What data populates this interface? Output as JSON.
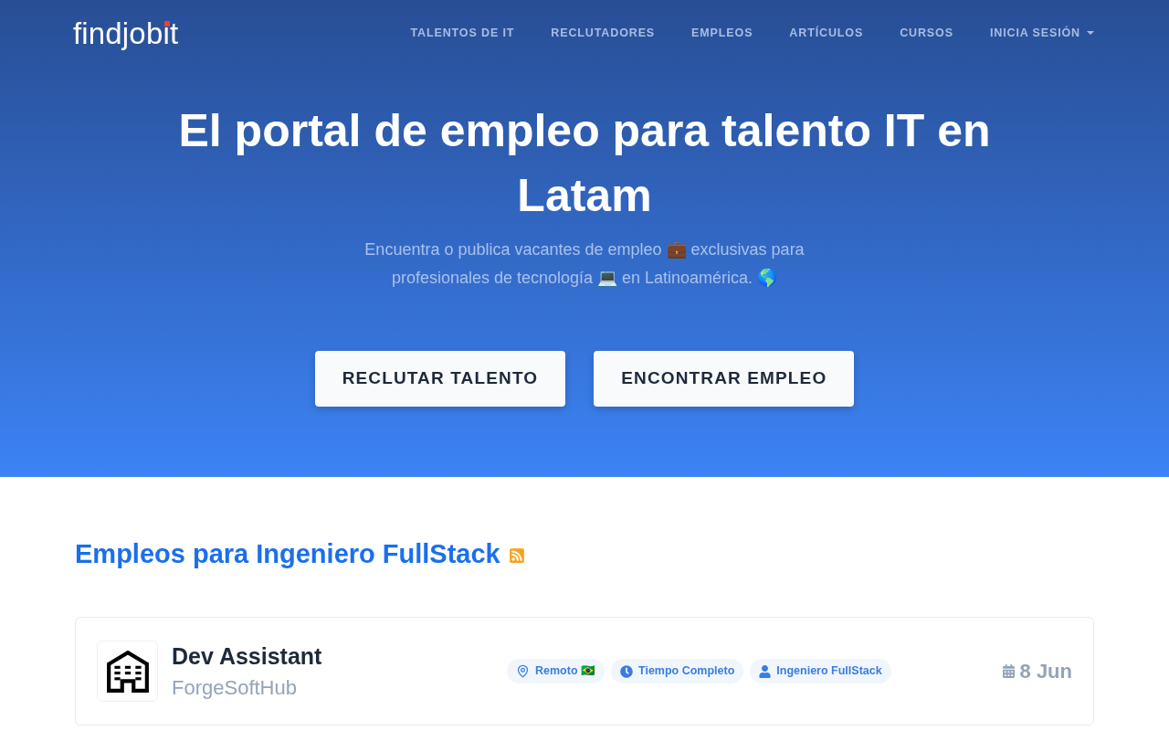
{
  "nav": {
    "logo": "findjobit",
    "items": [
      {
        "label": "TALENTOS DE IT",
        "kind": "link"
      },
      {
        "label": "RECLUTADORES",
        "kind": "link"
      },
      {
        "label": "EMPLEOS",
        "kind": "link"
      },
      {
        "label": "ARTÍCULOS",
        "kind": "link"
      },
      {
        "label": "CURSOS",
        "kind": "link"
      },
      {
        "label": "INICIA SESIÓN",
        "kind": "dropdown"
      }
    ]
  },
  "hero": {
    "title": "El portal de empleo para talento IT en Latam",
    "subtitle": "Encuentra o publica vacantes de empleo 💼 exclusivas para profesionales de tecnología 💻 en Latinoamérica. 🌎",
    "buttons": [
      "RECLUTAR TALENTO",
      "ENCONTRAR EMPLEO"
    ]
  },
  "jobs": {
    "heading": "Empleos para Ingeniero FullStack",
    "items": [
      {
        "title": "Dev Assistant",
        "company": "ForgeSoftHub",
        "tags": [
          {
            "kind": "location",
            "label": "Remoto 🇧🇷"
          },
          {
            "kind": "schedule",
            "label": "Tiempo Completo"
          },
          {
            "kind": "role",
            "label": "Ingeniero FullStack"
          }
        ],
        "date": "8 Jun"
      }
    ]
  }
}
